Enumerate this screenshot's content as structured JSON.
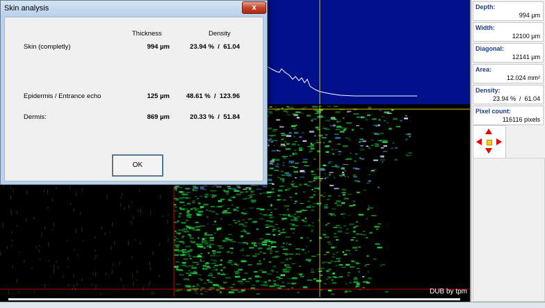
{
  "dialog": {
    "title": "Skin analysis",
    "close_glyph": "x",
    "headers": {
      "thickness": "Thickness",
      "density": "Density"
    },
    "rows": [
      {
        "label": "Skin (completly)",
        "thickness": "994 µm",
        "density": "23.94 %  /  61.04"
      },
      {
        "label": "Epidermis / Entrance echo",
        "thickness": "125 µm",
        "density": "48.61 %  /  123.96"
      },
      {
        "label": "Dermis:",
        "thickness": "869 µm",
        "density": "20.33 %  /  51.84"
      }
    ],
    "ok_label": "OK"
  },
  "panel": [
    {
      "label": "Depth:",
      "value": "994 µm"
    },
    {
      "label": "Width:",
      "value": "12100 µm"
    },
    {
      "label": "Diagonal:",
      "value": "12141 µm"
    },
    {
      "label": "Area:",
      "value": "12.024 mm²"
    },
    {
      "label": "Density:",
      "value": "23.94 %  /  61.04"
    },
    {
      "label": "Pixel count:",
      "value": "116116 pixels"
    }
  ],
  "viewer": {
    "watermark": "DUB by tpm"
  },
  "colors": {
    "histogram_bg": "#00108a",
    "cursor_line": "#d8c800",
    "boundary_line": "#c00000",
    "echo_green": "#1fc23a",
    "panel_label": "#1a3c8c"
  },
  "icons": [
    "close-icon",
    "arrow-up-icon",
    "arrow-down-icon",
    "arrow-left-icon",
    "arrow-right-icon",
    "center-dot-icon"
  ]
}
